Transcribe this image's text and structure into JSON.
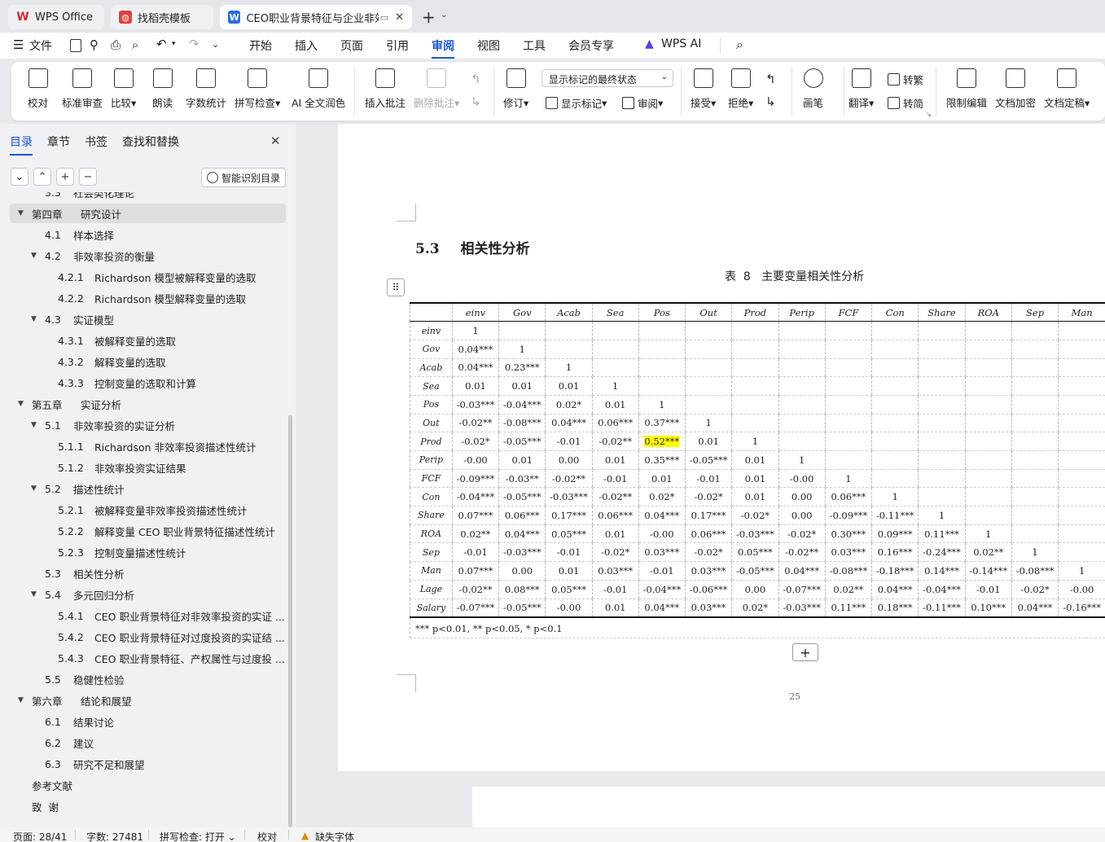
{
  "tabs": [
    {
      "label": "WPS Office",
      "icon": "wps-logo-icon"
    },
    {
      "label": "找稻壳模板",
      "icon": "docer-icon"
    },
    {
      "label": "CEO职业背景特征与企业非效率",
      "icon": "word-doc-icon"
    }
  ],
  "menu": {
    "file": "文件",
    "items": [
      "开始",
      "插入",
      "页面",
      "引用",
      "审阅",
      "视图",
      "工具",
      "会员专享"
    ],
    "active": "审阅",
    "ai": "WPS AI"
  },
  "ribbon": {
    "proofread": "校对",
    "std_review": "标准审查",
    "compare": "比较",
    "read_aloud": "朗读",
    "word_count": "字数统计",
    "spell_check": "拼写检查",
    "ai_polish": "AI 全文润色",
    "insert_comment": "插入批注",
    "delete_comment": "删除批注",
    "revise": "修订",
    "display_state": "显示标记的最终状态",
    "show_markup": "显示标记",
    "review_pane": "审阅",
    "accept": "接受",
    "reject": "拒绝",
    "pen": "画笔",
    "translate": "翻译",
    "to_traditional": "转繁",
    "to_simplified": "转简",
    "restrict_edit": "限制编辑",
    "encrypt": "文档加密",
    "finalize": "文档定稿"
  },
  "panel": {
    "tabs": [
      "目录",
      "章节",
      "书签",
      "查找和替换"
    ],
    "smart_toc": "智能识别目录",
    "items": [
      {
        "level": 2,
        "num": "3.3",
        "text": "社会类化理论",
        "partial": true
      },
      {
        "level": 1,
        "num": "第四章",
        "text": "研究设计",
        "expanded": true,
        "selected": true
      },
      {
        "level": 2,
        "num": "4.1",
        "text": "样本选择"
      },
      {
        "level": 2,
        "num": "4.2",
        "text": "非效率投资的衡量",
        "expanded": true
      },
      {
        "level": 3,
        "num": "4.2.1",
        "text": "Richardson 模型被解释变量的选取"
      },
      {
        "level": 3,
        "num": "4.2.2",
        "text": "Richardson 模型解释变量的选取"
      },
      {
        "level": 2,
        "num": "4.3",
        "text": "实证模型",
        "expanded": true
      },
      {
        "level": 3,
        "num": "4.3.1",
        "text": "被解释变量的选取"
      },
      {
        "level": 3,
        "num": "4.3.2",
        "text": "解释变量的选取"
      },
      {
        "level": 3,
        "num": "4.3.3",
        "text": "控制变量的选取和计算"
      },
      {
        "level": 1,
        "num": "第五章",
        "text": "实证分析",
        "expanded": true
      },
      {
        "level": 2,
        "num": "5.1",
        "text": "非效率投资的实证分析",
        "expanded": true
      },
      {
        "level": 3,
        "num": "5.1.1",
        "text": "Richardson 非效率投资描述性统计"
      },
      {
        "level": 3,
        "num": "5.1.2",
        "text": "非效率投资实证结果"
      },
      {
        "level": 2,
        "num": "5.2",
        "text": "描述性统计",
        "expanded": true
      },
      {
        "level": 3,
        "num": "5.2.1",
        "text": "被解释变量非效率投资描述性统计"
      },
      {
        "level": 3,
        "num": "5.2.2",
        "text": "解释变量 CEO 职业背景特征描述性统计"
      },
      {
        "level": 3,
        "num": "5.2.3",
        "text": "控制变量描述性统计"
      },
      {
        "level": 2,
        "num": "5.3",
        "text": "相关性分析"
      },
      {
        "level": 2,
        "num": "5.4",
        "text": "多元回归分析",
        "expanded": true
      },
      {
        "level": 3,
        "num": "5.4.1",
        "text": "CEO 职业背景特征对非效率投资的实证 ..."
      },
      {
        "level": 3,
        "num": "5.4.2",
        "text": "CEO 职业背景特征对过度投资的实证结 ..."
      },
      {
        "level": 3,
        "num": "5.4.3",
        "text": "CEO 职业背景特征、产权属性与过度投 ..."
      },
      {
        "level": 2,
        "num": "5.5",
        "text": "稳健性检验"
      },
      {
        "level": 1,
        "num": "第六章",
        "text": "结论和展望",
        "expanded": true
      },
      {
        "level": 2,
        "num": "6.1",
        "text": "结果讨论"
      },
      {
        "level": 2,
        "num": "6.2",
        "text": "建议"
      },
      {
        "level": 2,
        "num": "6.3",
        "text": "研究不足和展望"
      },
      {
        "level": 0,
        "num": "",
        "text": "参考文献"
      },
      {
        "level": 0,
        "num": "",
        "text": "致  谢"
      }
    ]
  },
  "doc": {
    "section_num": "5.3",
    "section_title": "相关性分析",
    "table_caption": "表  8   主要变量相关性分析",
    "columns": [
      "einv",
      "Gov",
      "Acab",
      "Sea",
      "Pos",
      "Out",
      "Prod",
      "Perip",
      "FCF",
      "Con",
      "Share",
      "ROA",
      "Sep",
      "Man"
    ],
    "rows": [
      {
        "label": "einv",
        "cells": [
          "1"
        ]
      },
      {
        "label": "Gov",
        "cells": [
          "0.04***",
          "1"
        ]
      },
      {
        "label": "Acab",
        "cells": [
          "0.04***",
          "0.23***",
          "1"
        ]
      },
      {
        "label": "Sea",
        "cells": [
          "0.01",
          "0.01",
          "0.01",
          "1"
        ]
      },
      {
        "label": "Pos",
        "cells": [
          "-0.03***",
          "-0.04***",
          "0.02*",
          "0.01",
          "1"
        ]
      },
      {
        "label": "Out",
        "cells": [
          "-0.02**",
          "-0.08***",
          "0.04***",
          "0.06***",
          "0.37***",
          "1"
        ]
      },
      {
        "label": "Prod",
        "cells": [
          "-0.02*",
          "-0.05***",
          "-0.01",
          "-0.02**",
          "0.52***",
          "0.01",
          "1"
        ]
      },
      {
        "label": "Perip",
        "cells": [
          "-0.00",
          "0.01",
          "0.00",
          "0.01",
          "0.35***",
          "-0.05***",
          "0.01",
          "1"
        ]
      },
      {
        "label": "FCF",
        "cells": [
          "-0.09***",
          "-0.03**",
          "-0.02**",
          "-0.01",
          "0.01",
          "-0.01",
          "0.01",
          "-0.00",
          "1"
        ]
      },
      {
        "label": "Con",
        "cells": [
          "-0.04***",
          "-0.05***",
          "-0.03***",
          "-0.02**",
          "0.02*",
          "-0.02*",
          "0.01",
          "0.00",
          "0.06***",
          "1"
        ]
      },
      {
        "label": "Share",
        "cells": [
          "0.07***",
          "0.06***",
          "0.17***",
          "0.06***",
          "0.04***",
          "0.17***",
          "-0.02*",
          "0.00",
          "-0.09***",
          "-0.11***",
          "1"
        ]
      },
      {
        "label": "ROA",
        "cells": [
          "0.02**",
          "0.04***",
          "0.05***",
          "0.01",
          "-0.00",
          "0.06***",
          "-0.03***",
          "-0.02*",
          "0.30***",
          "0.09***",
          "0.11***",
          "1"
        ]
      },
      {
        "label": "Sep",
        "cells": [
          "-0.01",
          "-0.03***",
          "-0.01",
          "-0.02*",
          "0.03***",
          "-0.02*",
          "0.05***",
          "-0.02**",
          "0.03***",
          "0.16***",
          "-0.24***",
          "0.02**",
          "1"
        ]
      },
      {
        "label": "Man",
        "cells": [
          "0.07***",
          "0.00",
          "0.01",
          "0.03***",
          "-0.01",
          "0.03***",
          "-0.05***",
          "0.04***",
          "-0.08***",
          "-0.18***",
          "0.14***",
          "-0.14***",
          "-0.08***",
          "1"
        ]
      },
      {
        "label": "Lage",
        "cells": [
          "-0.02**",
          "0.08***",
          "0.05***",
          "-0.01",
          "-0.04***",
          "-0.06***",
          "0.00",
          "-0.07***",
          "0.02**",
          "0.04***",
          "-0.04***",
          "-0.01",
          "-0.02*",
          "-0.00"
        ]
      },
      {
        "label": "Salary",
        "cells": [
          "-0.07***",
          "-0.05***",
          "-0.00",
          "0.01",
          "0.04***",
          "0.03***",
          "0.02*",
          "-0.03***",
          "0.11***",
          "0.18***",
          "-0.11***",
          "0.10***",
          "0.04***",
          "-0.16***"
        ]
      }
    ],
    "highlight": {
      "row": "Prod",
      "col": "Pos"
    },
    "footnote": "*** p<0.01, ** p<0.05, * p<0.1",
    "page_number": "25"
  },
  "status": {
    "page": "页面: 28/41",
    "words": "字数: 27481",
    "spell": "拼写检查: 打开",
    "proof": "校对",
    "missing_font": "缺失字体"
  }
}
